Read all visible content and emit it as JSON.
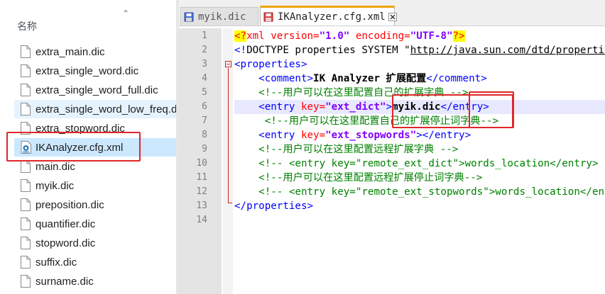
{
  "explorer": {
    "column_header": "名称",
    "files": [
      {
        "name": "extra_main.dic",
        "state": "normal"
      },
      {
        "name": "extra_single_word.dic",
        "state": "normal"
      },
      {
        "name": "extra_single_word_full.dic",
        "state": "normal"
      },
      {
        "name": "extra_single_word_low_freq.dic",
        "state": "hover"
      },
      {
        "name": "extra_stopword.dic",
        "state": "normal"
      },
      {
        "name": "IKAnalyzer.cfg.xml",
        "state": "selected",
        "icon": "config-file-icon"
      },
      {
        "name": "main.dic",
        "state": "normal"
      },
      {
        "name": "myik.dic",
        "state": "normal"
      },
      {
        "name": "preposition.dic",
        "state": "normal"
      },
      {
        "name": "quantifier.dic",
        "state": "normal"
      },
      {
        "name": "stopword.dic",
        "state": "normal"
      },
      {
        "name": "suffix.dic",
        "state": "normal"
      },
      {
        "name": "surname.dic",
        "state": "normal"
      }
    ]
  },
  "editor": {
    "tabs": [
      {
        "label": "myik.dic",
        "active": false
      },
      {
        "label": "IKAnalyzer.cfg.xml",
        "active": true
      }
    ],
    "line_numbers": [
      "1",
      "2",
      "3",
      "4",
      "5",
      "6",
      "7",
      "8",
      "9",
      "10",
      "11",
      "12",
      "13",
      "14"
    ],
    "lines": {
      "l1": {
        "a": "<?",
        "b": "xml",
        "c": " version=",
        "d": "\"1.0\"",
        "e": " encoding=",
        "f": "\"UTF-8\"",
        "g": "?>"
      },
      "l2": {
        "a": "<!",
        "b": "DOCTYPE properties SYSTEM \"",
        "c": "http://java.sun.com/dtd/properties.dtd",
        "d": "\">"
      },
      "l3": {
        "a": "<properties>"
      },
      "l4": {
        "indent": "    ",
        "a": "<comment>",
        "b": "IK Analyzer 扩展配置",
        "c": "</comment>"
      },
      "l5": {
        "indent": "    ",
        "a": "<!--用户可以在这里配置自己的扩展字典 -->"
      },
      "l6": {
        "indent": "    ",
        "a": "<entry",
        "b": " key=",
        "c": "\"ext_dict\"",
        "d": ">",
        "e": "myik.dic",
        "f": "</entry>"
      },
      "l7": {
        "indent": "     ",
        "a": "<!--用户可以在这里配置自己的扩展停止词字典-->"
      },
      "l8": {
        "indent": "    ",
        "a": "<entry",
        "b": " key=",
        "c": "\"ext_stopwords\"",
        "d": "></entry>"
      },
      "l9": {
        "indent": "    ",
        "a": "<!--用户可以在这里配置远程扩展字典 -->"
      },
      "l10": {
        "indent": "    ",
        "a": "<!-- <entry key=\"remote_ext_dict\">words_location</entry> -->"
      },
      "l11": {
        "indent": "    ",
        "a": "<!--用户可以在这里配置远程扩展停止词字典-->"
      },
      "l12": {
        "indent": "    ",
        "a": "<!-- <entry key=\"remote_ext_stopwords\">words_location</entry> -->"
      },
      "l13": {
        "a": "</properties>"
      },
      "l14": {
        "a": ""
      }
    }
  },
  "colors": {
    "annotation_red": "#e0262a",
    "selected_row": "#cce8ff",
    "hover_row": "#e5f3ff",
    "active_tab_accent": "#f0a30a",
    "current_line": "#e8e8ff"
  }
}
